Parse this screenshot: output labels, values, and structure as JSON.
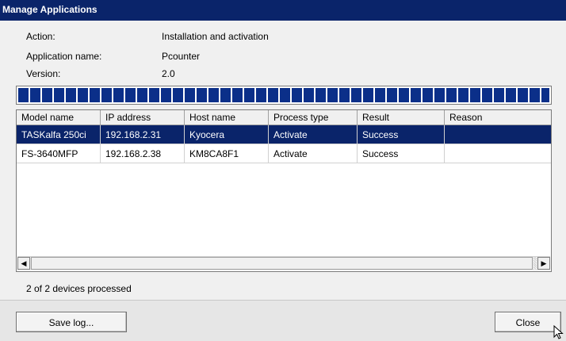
{
  "window": {
    "title": "Manage Applications"
  },
  "info": {
    "action_label": "Action:",
    "action_value": "Installation and activation",
    "app_name_label": "Application name:",
    "app_name_value": "Pcounter",
    "version_label": "Version:",
    "version_value": "2.0"
  },
  "progress": {
    "fraction": 1.0,
    "color": "#0b2f89"
  },
  "table": {
    "columns": [
      "Model name",
      "IP address",
      "Host name",
      "Process type",
      "Result",
      "Reason"
    ],
    "rows": [
      {
        "model": "TASKalfa 250ci",
        "ip": "192.168.2.31",
        "host": "Kyocera",
        "process": "Activate",
        "result": "Success",
        "reason": ""
      },
      {
        "model": "FS-3640MFP",
        "ip": "192.168.2.38",
        "host": "KM8CA8F1",
        "process": "Activate",
        "result": "Success",
        "reason": ""
      }
    ],
    "selected_row": 0
  },
  "status": {
    "text": "2 of 2 devices processed"
  },
  "buttons": {
    "save_log": "Save log...",
    "close": "Close"
  },
  "colors": {
    "titlebar": "#0a246a",
    "selection": "#0a246a"
  }
}
